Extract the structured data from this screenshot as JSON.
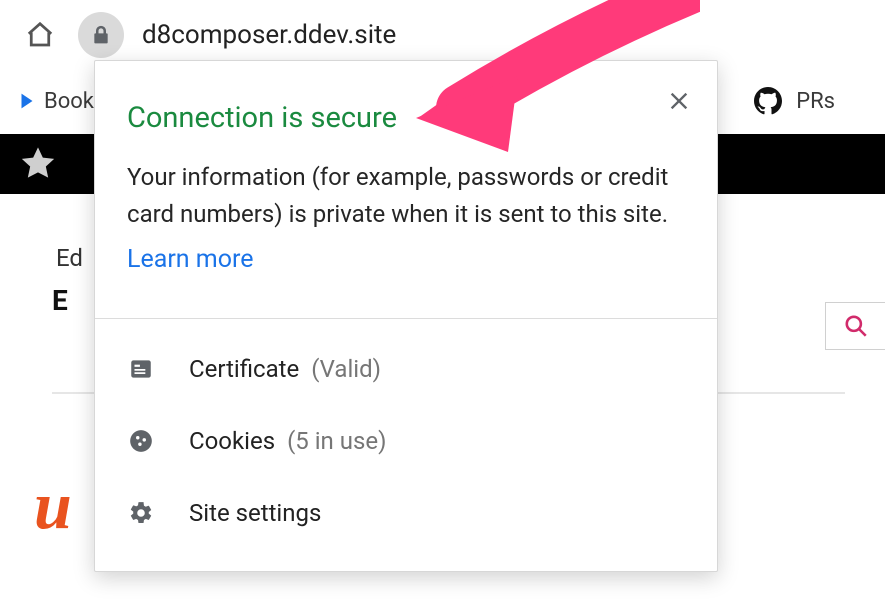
{
  "address_bar": {
    "url": "d8composer.ddev.site"
  },
  "bookmarks": {
    "left_fragment": "Bookm",
    "right_label": "PRs"
  },
  "page": {
    "nav_fragment": "Ed",
    "title_fragment": "E"
  },
  "popover": {
    "title": "Connection is secure",
    "description": "Your information (for example, passwords or credit card numbers) is private when it is sent to this site.",
    "learn_more": "Learn more",
    "rows": {
      "certificate": {
        "label": "Certificate",
        "paren": "(Valid)"
      },
      "cookies": {
        "label": "Cookies",
        "paren": "(5 in use)"
      },
      "settings": {
        "label": "Site settings"
      }
    }
  }
}
